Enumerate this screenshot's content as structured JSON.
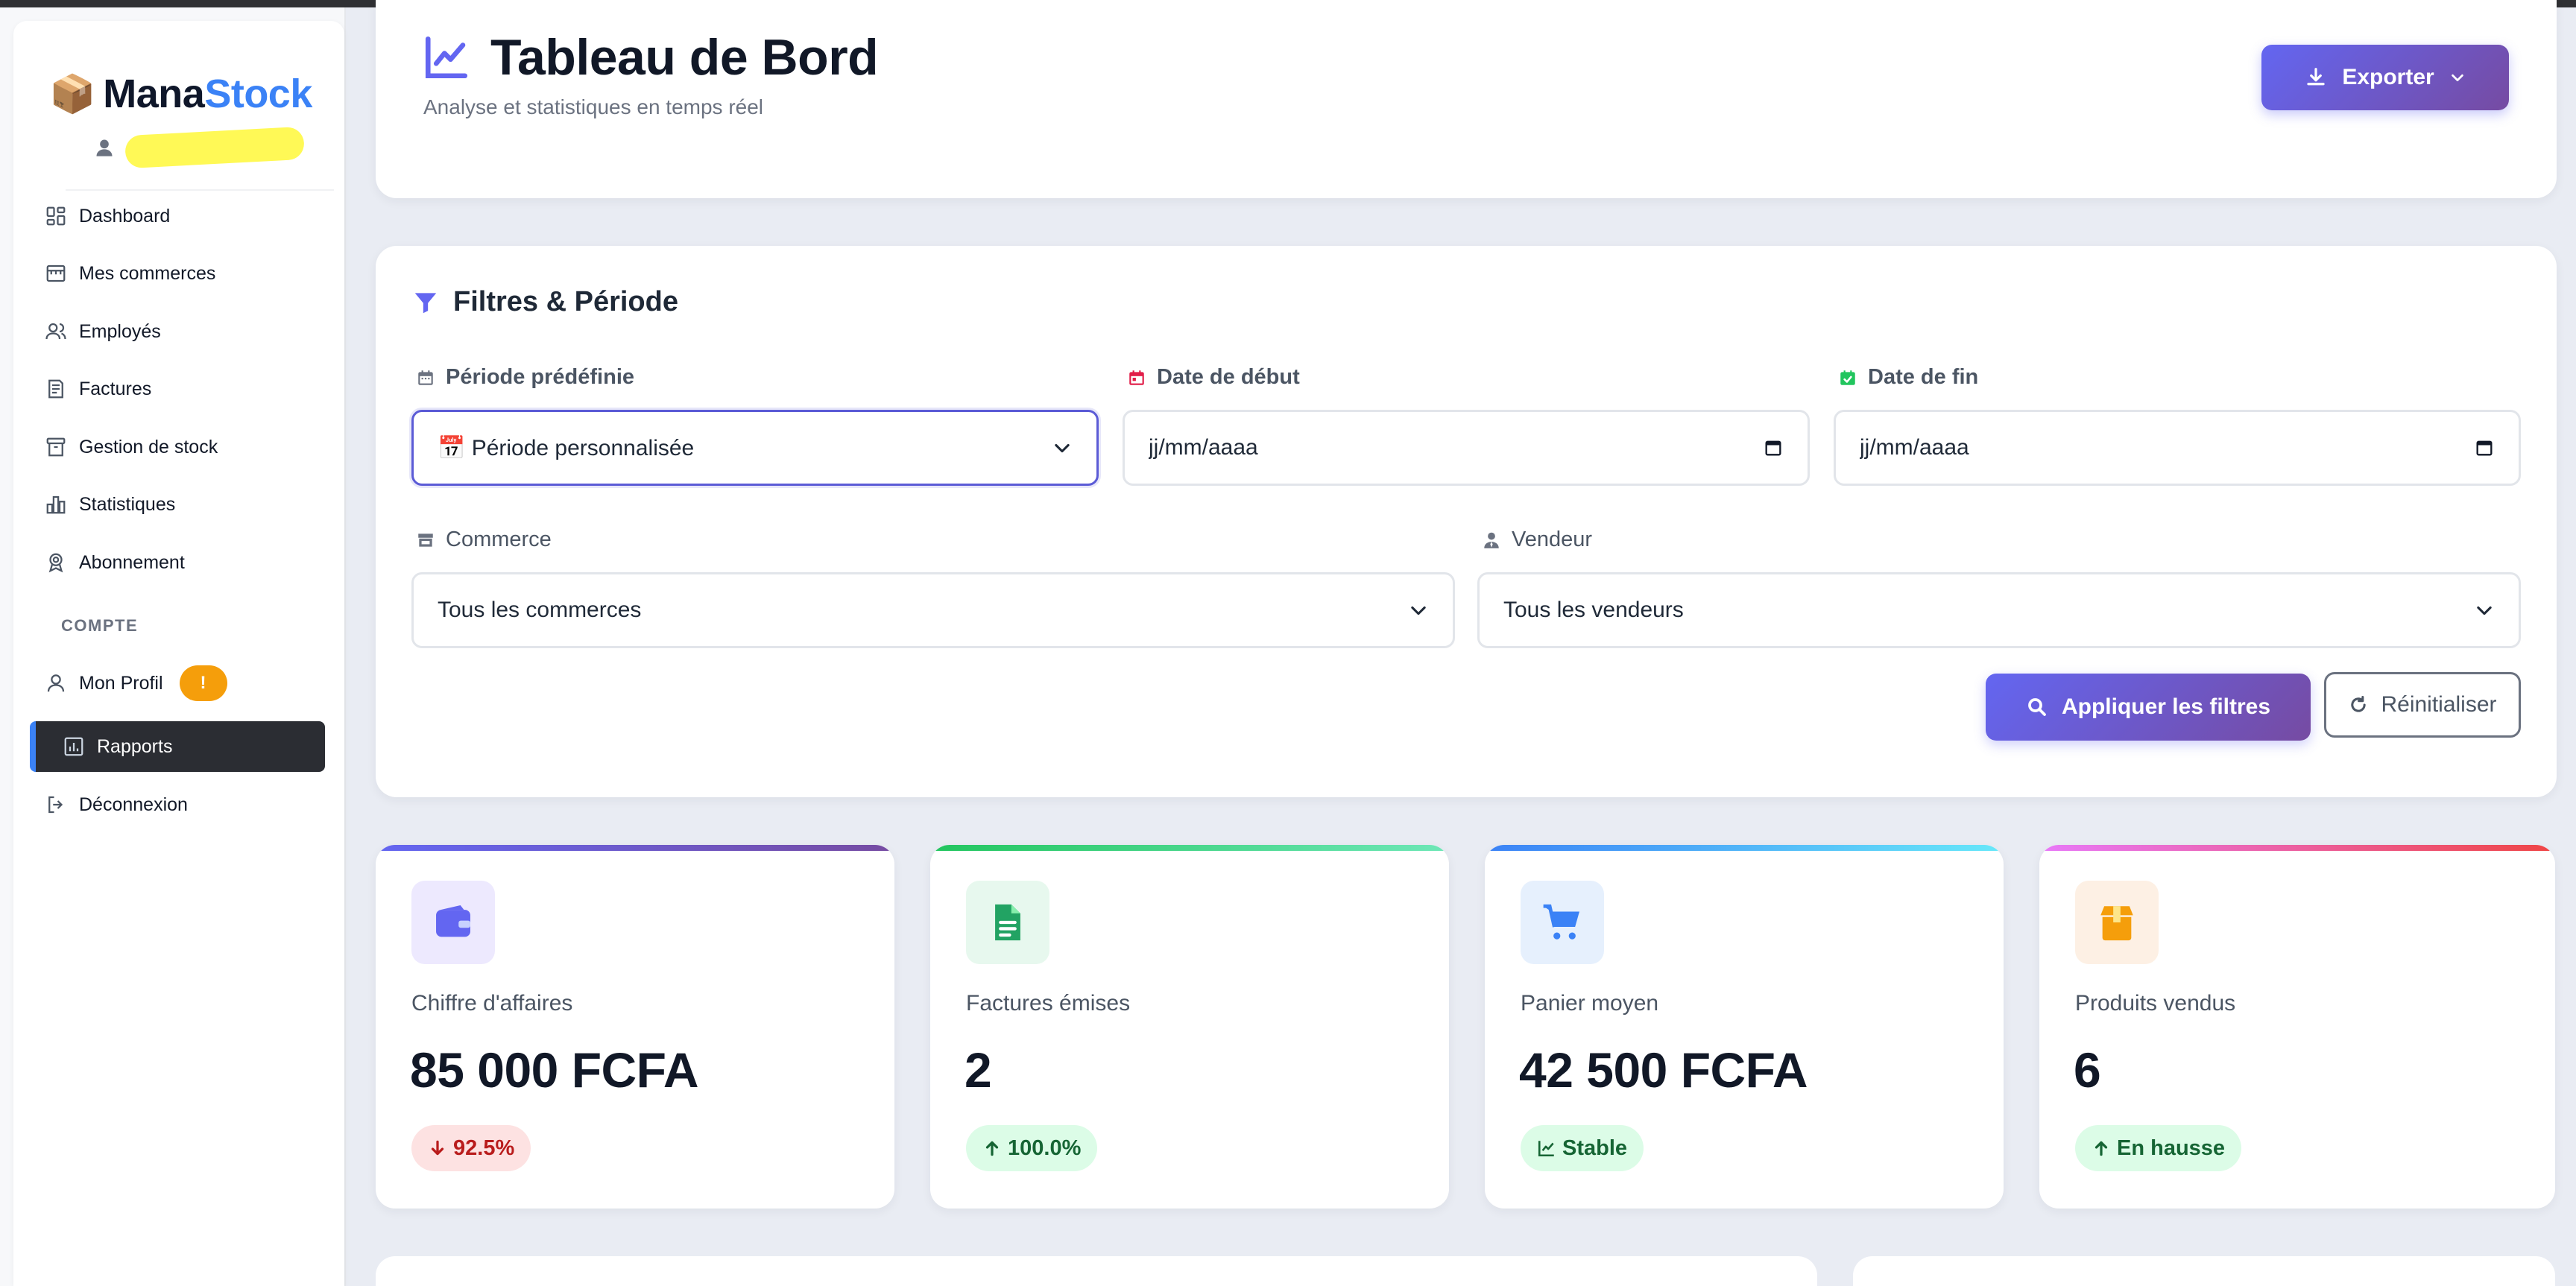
{
  "app": {
    "logo_emoji": "📦",
    "brand_part1": "Mana",
    "brand_part2": "Stock"
  },
  "sidebar": {
    "items": [
      {
        "label": "Dashboard",
        "icon": "dashboard-icon"
      },
      {
        "label": "Mes commerces",
        "icon": "store-icon"
      },
      {
        "label": "Employés",
        "icon": "users-icon"
      },
      {
        "label": "Factures",
        "icon": "invoice-icon"
      },
      {
        "label": "Gestion de stock",
        "icon": "archive-icon"
      },
      {
        "label": "Statistiques",
        "icon": "bar-chart-icon"
      },
      {
        "label": "Abonnement",
        "icon": "award-icon"
      }
    ],
    "section_label": "COMPTE",
    "profile_label": "Mon Profil",
    "profile_badge": "!",
    "active_label": "Rapports",
    "logout_label": "Déconnexion"
  },
  "header": {
    "title": "Tableau de Bord",
    "subtitle": "Analyse et statistiques en temps réel",
    "export_label": "Exporter"
  },
  "filters": {
    "title": "Filtres & Période",
    "period_label": "Période prédéfinie",
    "period_value": "📅 Période personnalisée",
    "start_label": "Date de début",
    "start_value": "jj/mm/aaaa",
    "end_label": "Date de fin",
    "end_value": "jj/mm/aaaa",
    "commerce_label": "Commerce",
    "commerce_value": "Tous les commerces",
    "seller_label": "Vendeur",
    "seller_value": "Tous les vendeurs",
    "apply_label": "Appliquer les filtres",
    "reset_label": "Réinitialiser"
  },
  "stats": [
    {
      "label": "Chiffre d'affaires",
      "value": "85 000 FCFA",
      "trend": "92.5%",
      "direction": "down",
      "icon": "wallet-icon",
      "color": "#6366f1"
    },
    {
      "label": "Factures émises",
      "value": "2",
      "trend": "100.0%",
      "direction": "up",
      "icon": "file-icon",
      "color": "#22c55e"
    },
    {
      "label": "Panier moyen",
      "value": "42 500 FCFA",
      "trend": "Stable",
      "direction": "stable",
      "icon": "cart-icon",
      "color": "#3b82f6"
    },
    {
      "label": "Produits vendus",
      "value": "6",
      "trend": "En hausse",
      "direction": "up",
      "icon": "box-icon",
      "color": "#f59e0b"
    }
  ]
}
